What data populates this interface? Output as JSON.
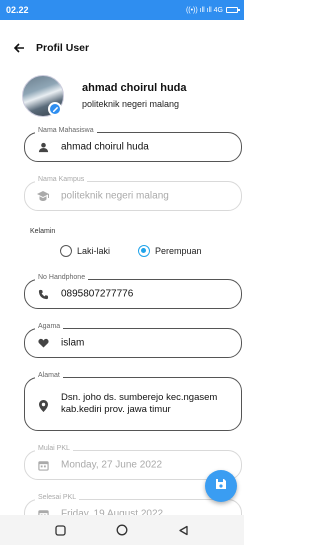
{
  "status": {
    "time": "02.22",
    "signal_text": "((•)) ıll ıll 4G"
  },
  "appbar": {
    "title": "Profil User"
  },
  "profile": {
    "name": "ahmad choirul huda",
    "campus": "politeknik negeri malang"
  },
  "fields": {
    "nama": {
      "label": "Nama Mahasiswa",
      "value": "ahmad choirul huda",
      "icon": "person-icon"
    },
    "kampus": {
      "label": "Nama Kampus",
      "value": "politeknik negeri malang",
      "icon": "school-icon"
    },
    "hp": {
      "label": "No Handphone",
      "value": "0895807277776",
      "icon": "phone-icon"
    },
    "agama": {
      "label": "Agama",
      "value": "islam",
      "icon": "heart-icon"
    },
    "alamat": {
      "label": "Alamat",
      "value": "Dsn. joho ds. sumberejo kec.ngasem kab.kediri prov. jawa timur",
      "icon": "location-icon"
    },
    "mulai": {
      "label": "Mulai PKL",
      "value": "Monday, 27 June 2022",
      "icon": "calendar-icon"
    },
    "selesai": {
      "label": "Selesai PKL",
      "value": "Friday, 19 August 2022",
      "icon": "calendar-icon"
    }
  },
  "gender": {
    "label": "Kelamin",
    "options": [
      "Laki-laki",
      "Perempuan"
    ],
    "selected": "Perempuan"
  },
  "colors": {
    "primary": "#2f8ef0",
    "radio": "#1fa3ea"
  }
}
